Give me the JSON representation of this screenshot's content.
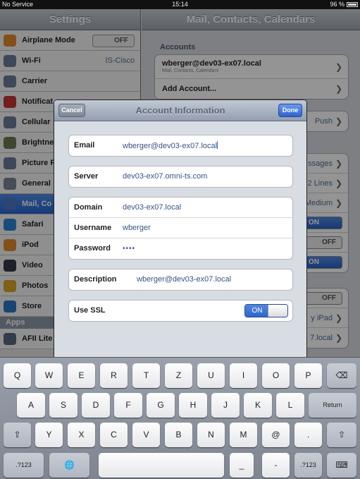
{
  "status_bar": {
    "carrier": "No Service",
    "time": "15:14",
    "battery": "96 %"
  },
  "master": {
    "title": "Settings",
    "items": [
      {
        "label": "Airplane Mode",
        "toggle": "OFF",
        "color": "#e08a2a"
      },
      {
        "label": "Wi-Fi",
        "value": "IS-Cisco",
        "color": "#6a7c99"
      },
      {
        "label": "Carrier",
        "color": "#6a7c99"
      },
      {
        "label": "Notificat",
        "color": "#c93535"
      },
      {
        "label": "Cellular",
        "color": "#6a7c99"
      },
      {
        "label": "Brightne",
        "color": "#6d7a4e"
      },
      {
        "label": "Picture F",
        "color": "#6a7c99"
      },
      {
        "label": "General",
        "color": "#7b8493"
      },
      {
        "label": "Mail, Co",
        "color": "#4d78c4",
        "selected": true
      },
      {
        "label": "Safari",
        "color": "#2a86d4"
      },
      {
        "label": "iPod",
        "color": "#e28b2c"
      },
      {
        "label": "Video",
        "color": "#333a47"
      },
      {
        "label": "Photos",
        "color": "#d9a526"
      },
      {
        "label": "Store",
        "color": "#2c78c9"
      }
    ],
    "apps_section": "Apps",
    "apps": [
      {
        "label": "AFII Lite",
        "color": "#596880"
      }
    ]
  },
  "detail": {
    "title": "Mail, Contacts, Calendars",
    "accounts_header": "Accounts",
    "account_name": "wberger@dev03-ex07.local",
    "account_sub": "Mail, Contacts, Calendars",
    "add_account": "Add Account...",
    "fetch_value": "Push",
    "partial_rows": [
      "ssages",
      "2 Lines",
      "Medium",
      "ON",
      "OFF",
      "ON",
      "OFF",
      "y iPad",
      "7.local"
    ]
  },
  "modal": {
    "title": "Account Information",
    "cancel": "Cancel",
    "done": "Done",
    "email_label": "Email",
    "email_value": "wberger@dev03-ex07.local",
    "server_label": "Server",
    "server_value": "dev03-ex07.omni-ts.com",
    "domain_label": "Domain",
    "domain_value": "dev03-ex07.local",
    "username_label": "Username",
    "username_value": "wberger",
    "password_label": "Password",
    "password_value": "••••",
    "description_label": "Description",
    "description_value": "wberger@dev03-ex07.local",
    "ssl_label": "Use SSL",
    "ssl_value": "ON"
  },
  "keyboard": {
    "row1": [
      "Q",
      "W",
      "E",
      "R",
      "T",
      "Z",
      "U",
      "I",
      "O",
      "P",
      "⌫"
    ],
    "row2": [
      "A",
      "S",
      "D",
      "F",
      "G",
      "H",
      "J",
      "K",
      "L",
      "Return"
    ],
    "row3": [
      "⇧",
      "Y",
      "X",
      "C",
      "V",
      "B",
      "N",
      "M",
      "@",
      ".",
      "⇧"
    ],
    "row4": [
      ".?123",
      "🌐",
      "",
      "_",
      "-",
      ".?123",
      "⌨"
    ]
  }
}
